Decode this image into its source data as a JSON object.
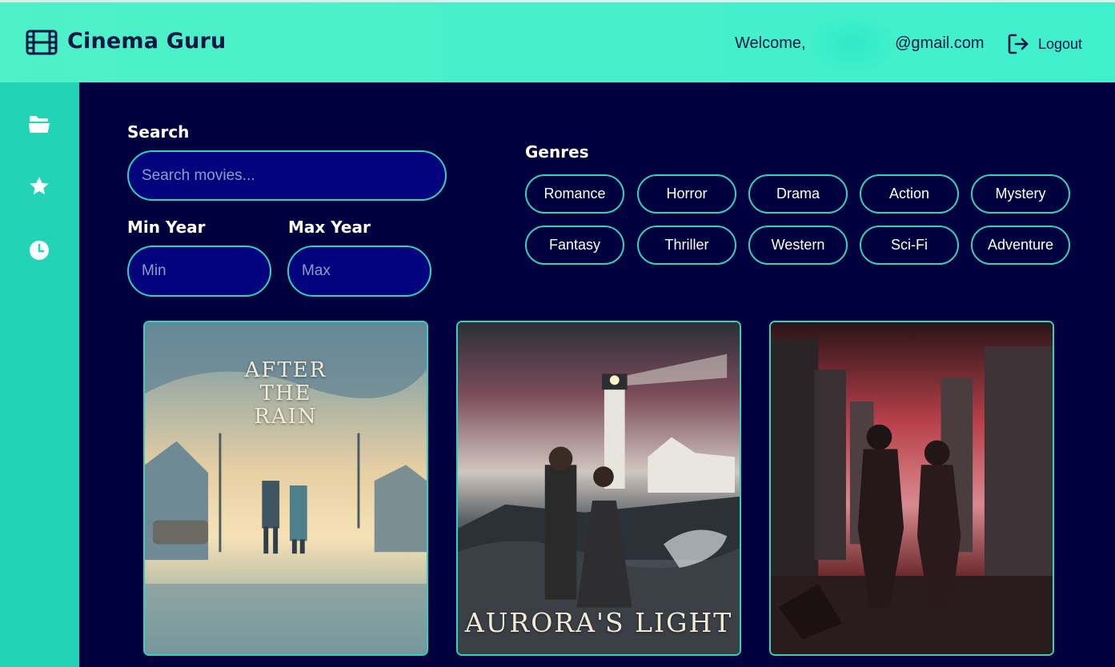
{
  "header": {
    "app_title": "Cinema Guru",
    "logo_icon": "film-icon",
    "welcome_prefix": "Welcome, ",
    "welcome_email_suffix": "@gmail.com",
    "logout_label": "Logout",
    "logout_icon": "logout-icon"
  },
  "sidebar": {
    "items": [
      {
        "icon": "folder-icon"
      },
      {
        "icon": "star-icon"
      },
      {
        "icon": "clock-icon"
      }
    ]
  },
  "filters": {
    "search_label": "Search",
    "search_placeholder": "Search movies...",
    "min_year_label": "Min Year",
    "min_year_placeholder": "Min",
    "max_year_label": "Max Year",
    "max_year_placeholder": "Max",
    "genres_label": "Genres",
    "genres": [
      "Romance",
      "Horror",
      "Drama",
      "Action",
      "Mystery",
      "Fantasy",
      "Thriller",
      "Western",
      "Sci-Fi",
      "Adventure"
    ]
  },
  "movies": [
    {
      "poster_title": [
        "AFTER",
        "THE",
        "RAIN"
      ]
    },
    {
      "poster_title": [
        "AURORA'S LIGHT"
      ]
    },
    {
      "poster_title": []
    }
  ],
  "colors": {
    "header_bg": "#3ff0cd",
    "sidebar_bg": "#22d3b5",
    "main_bg": "#01003e",
    "input_bg": "#03037d",
    "accent_border": "#2fd4b9",
    "text_dark": "#0b1747"
  }
}
